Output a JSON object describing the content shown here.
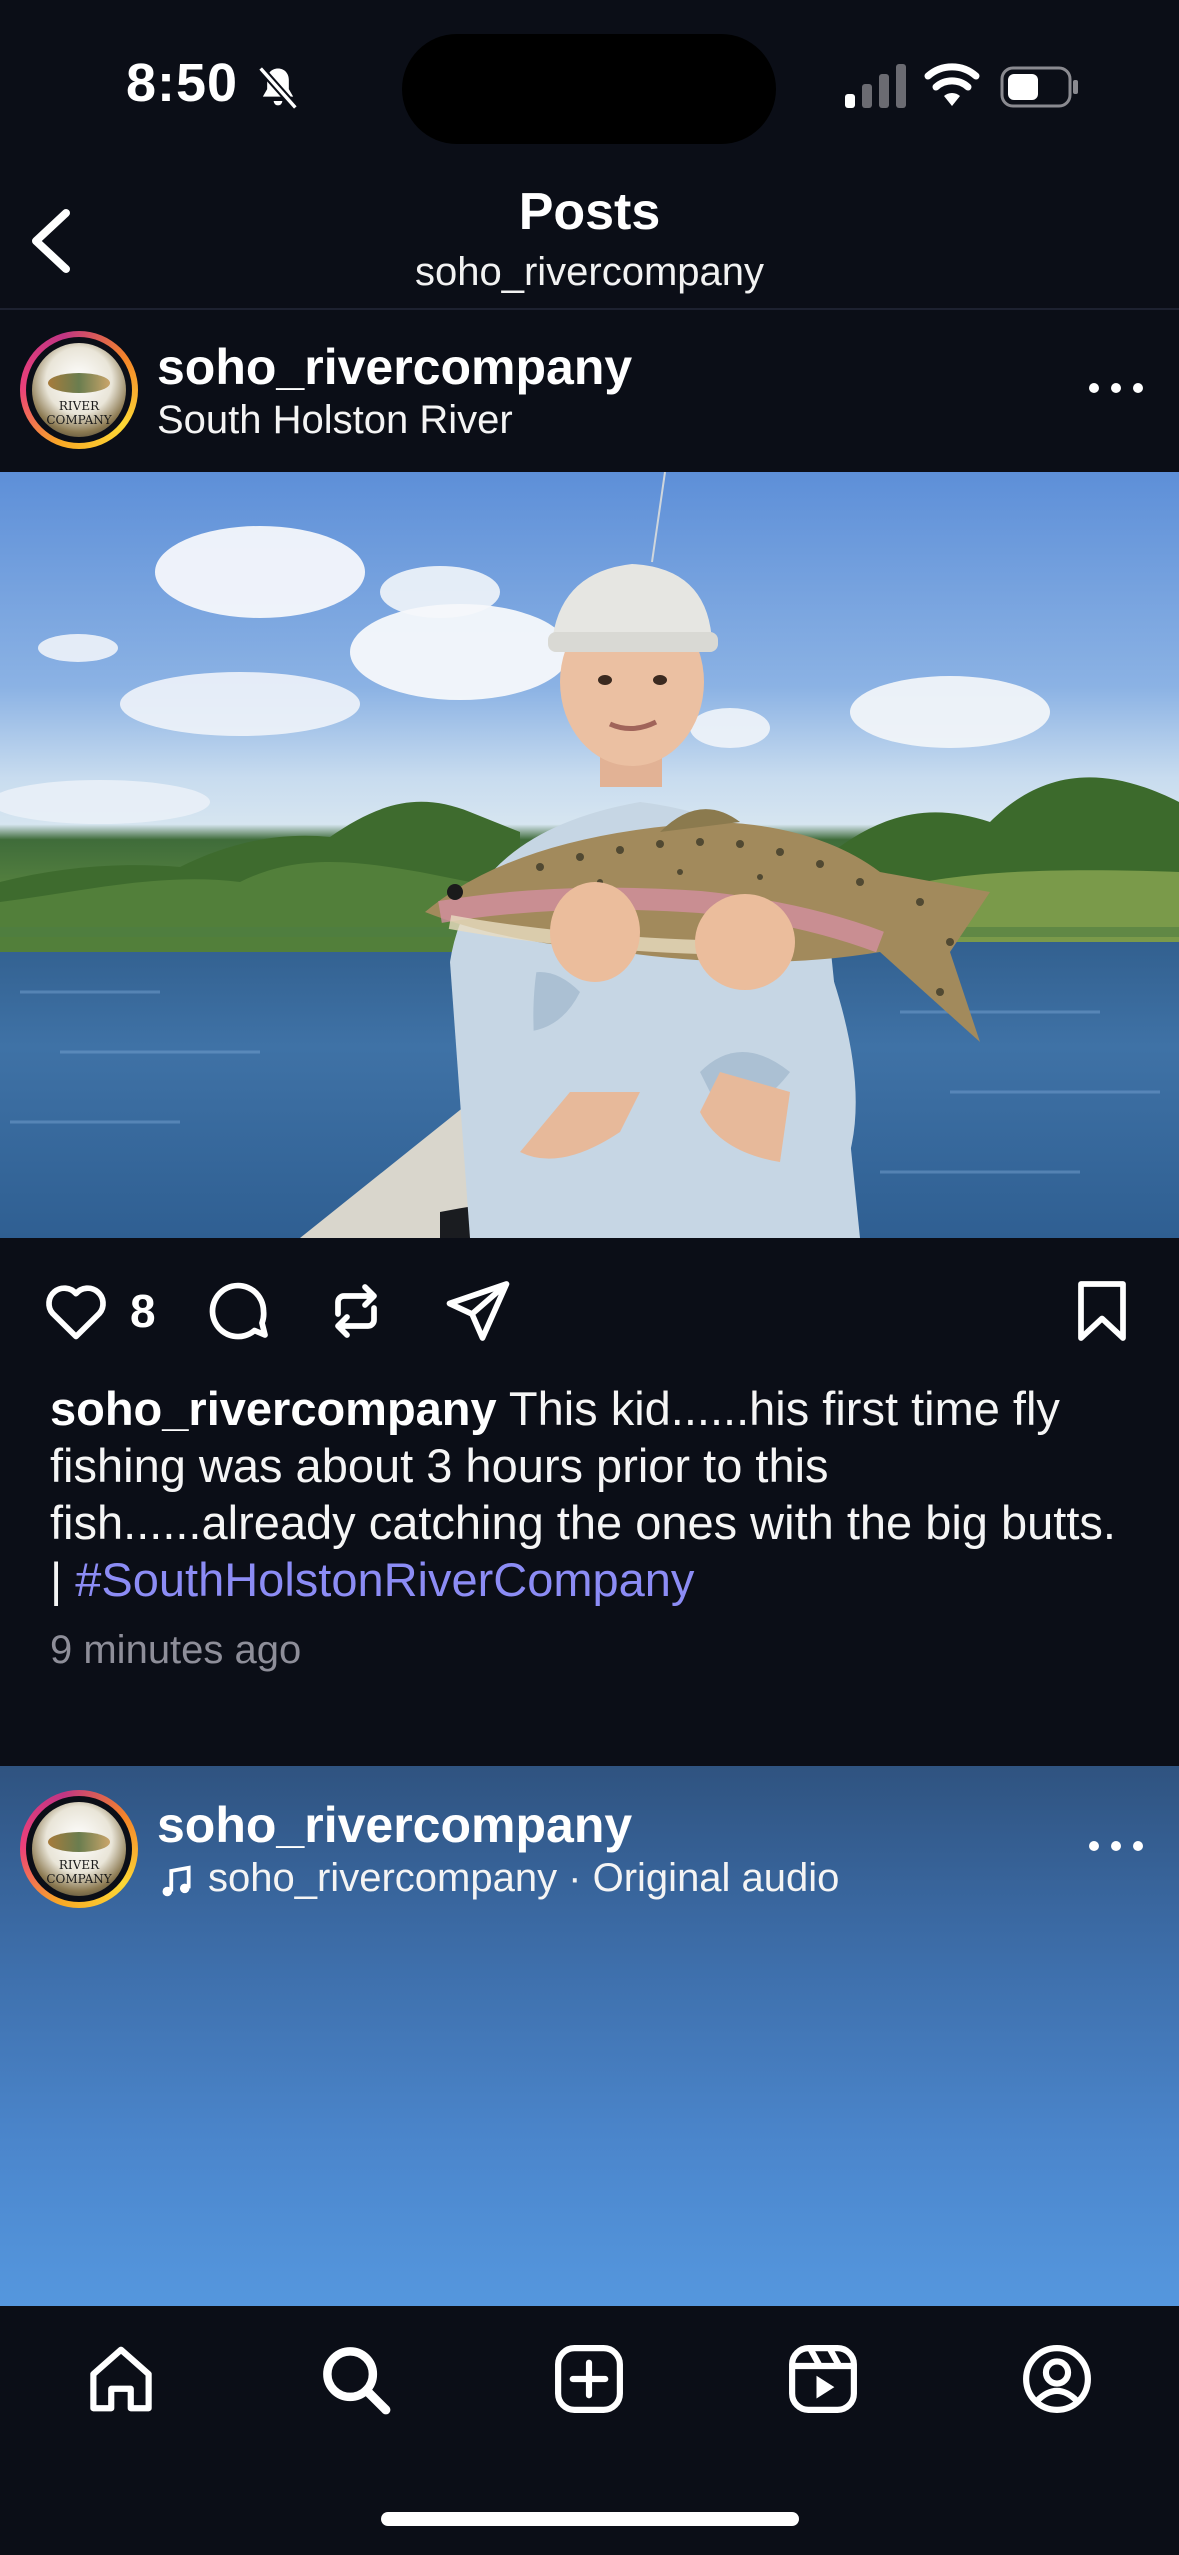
{
  "status_bar": {
    "time": "8:50",
    "icons": [
      "bell-slash-icon",
      "signal-icon",
      "wifi-icon",
      "battery-icon"
    ]
  },
  "header": {
    "title": "Posts",
    "subtitle": "soho_rivercompany",
    "back_icon": "chevron-left-icon"
  },
  "post": {
    "username": "soho_rivercompany",
    "location": "South Holston River",
    "avatar_text": "RIVER COMPANY",
    "likes": "8",
    "caption_user": "soho_rivercompany",
    "caption_text": " This kid......his first time fly fishing was about 3 hours prior to this fish......already catching the ones with the big butts. | ",
    "hashtag": "#SouthHolstonRiverCompany",
    "time_ago": "9 minutes ago",
    "actions": [
      "heart-icon",
      "comment-icon",
      "repost-icon",
      "share-icon",
      "bookmark-icon"
    ]
  },
  "post2": {
    "username": "soho_rivercompany",
    "audio": "soho_rivercompany · Original audio",
    "avatar_text": "RIVER COMPANY"
  },
  "tab_bar": {
    "items": [
      "home-icon",
      "search-icon",
      "create-icon",
      "reels-icon",
      "profile-icon"
    ]
  },
  "colors": {
    "background": "#0b0e17",
    "hashtag": "#8c8cf5",
    "muted_text": "#8e8e99"
  }
}
